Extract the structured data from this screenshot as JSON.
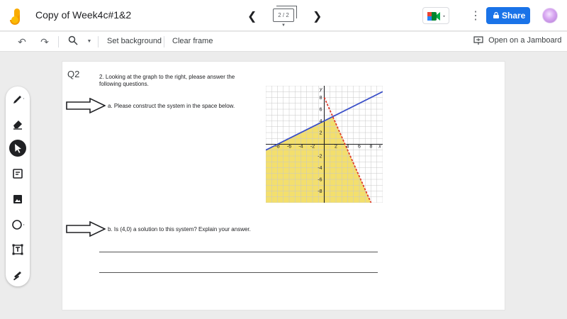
{
  "app": {
    "title": "Copy of Week4c#1&2",
    "frame_counter": "2 / 2",
    "share_label": "Share",
    "brand_colors": {
      "share": "#1a73e8",
      "logo_yellow": "#f9ab00",
      "logo_orange": "#f29900"
    }
  },
  "toolbar": {
    "set_background": "Set background",
    "clear_frame": "Clear frame",
    "open_on_jamboard": "Open on a Jamboard"
  },
  "side_tools": [
    "pen-icon",
    "eraser-icon",
    "select-icon",
    "sticky-note-icon",
    "image-icon",
    "circle-shape-icon",
    "text-box-icon",
    "laser-icon"
  ],
  "frame": {
    "question_label": "Q2",
    "intro_line1": "2.  Looking at the graph to the right, please answer the",
    "intro_line2": "following questions.",
    "part_a": "a.   Please construct the system in the space below.",
    "part_b": "b.   Is (4,0) a solution to this system? Explain your answer."
  },
  "chart_data": {
    "type": "line",
    "x_range": [
      -10,
      10
    ],
    "y_range": [
      -10,
      10
    ],
    "grid": true,
    "x_tick_labels": [
      "-8",
      "-6",
      "-4",
      "-2",
      "2",
      "4",
      "6",
      "8",
      "x"
    ],
    "y_tick_labels": [
      "y",
      "8",
      "6",
      "4",
      "2",
      "-2",
      "-4",
      "-6",
      "-8"
    ],
    "series": [
      {
        "style": "solid",
        "color": "#3b50c8",
        "points": [
          [
            -10,
            -1
          ],
          [
            10,
            9
          ]
        ]
      },
      {
        "style": "dashed",
        "color": "#e03c2c",
        "points": [
          [
            0,
            8
          ],
          [
            8,
            -10
          ]
        ]
      }
    ],
    "shaded_region": {
      "color": "#f2dc5d",
      "bounds": "below solid line and left of dashed line"
    }
  }
}
